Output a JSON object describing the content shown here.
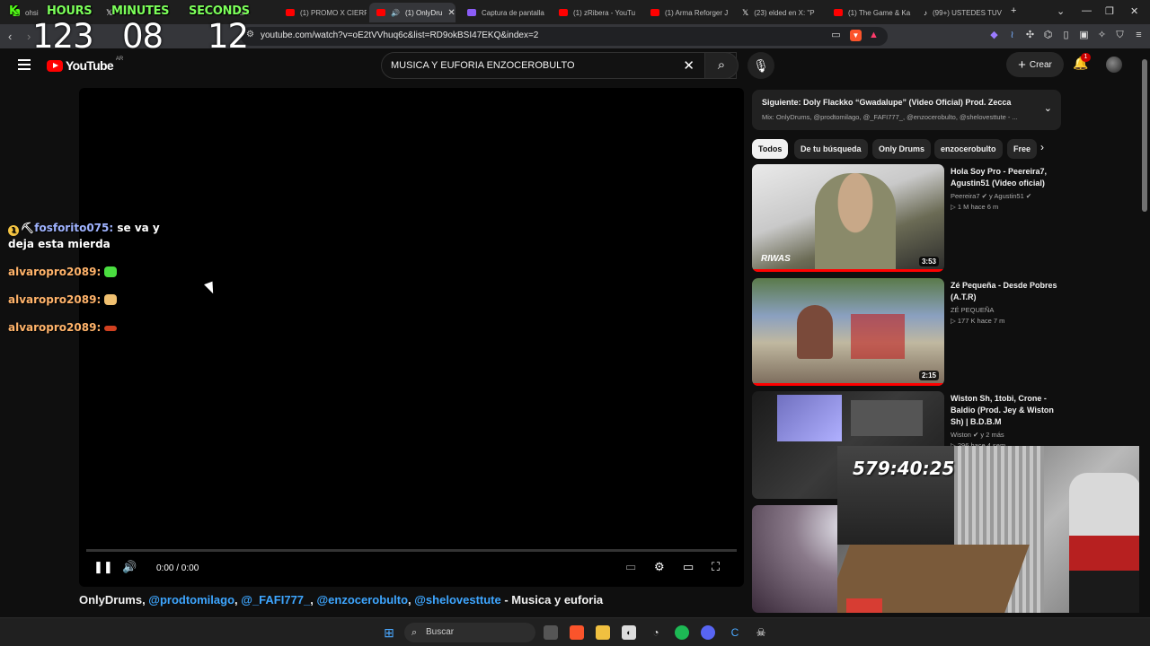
{
  "overlay": {
    "hours_label": "HOURS",
    "minutes_label": "MINUTES",
    "seconds_label": "SECONDS",
    "hours": "123",
    "minutes": "08",
    "seconds": "12"
  },
  "tabs": [
    {
      "label": "ohsi",
      "favicon": "kick-icon",
      "active": false
    },
    {
      "label": "",
      "favicon": "x-icon",
      "active": false
    },
    {
      "label": "ram",
      "favicon": "",
      "active": false
    },
    {
      "label": "(1) PROMO X CIERR",
      "favicon": "youtube-icon",
      "active": false
    },
    {
      "label": "(1) OnlyDru",
      "favicon": "youtube-icon",
      "active": true
    },
    {
      "label": "Captura de pantalla",
      "favicon": "pen-icon",
      "active": false
    },
    {
      "label": "(1) zRibera - YouTu",
      "favicon": "youtube-icon",
      "active": false
    },
    {
      "label": "(1) Arma Reforger J",
      "favicon": "youtube-icon",
      "active": false
    },
    {
      "label": "(23) elded en X: \"P",
      "favicon": "x-icon",
      "active": false
    },
    {
      "label": "(1) The Game & Ka",
      "favicon": "youtube-icon",
      "active": false
    },
    {
      "label": "(99+) USTEDES TUV",
      "favicon": "tiktok-icon",
      "active": false
    }
  ],
  "address": {
    "url": "youtube.com/watch?v=oE2tVVhuq6c&list=RD9okBSI47EKQ&index=2"
  },
  "youtube": {
    "logo_text": "YouTube",
    "country": "AR",
    "search_query": "MUSICA Y EUFORIA ENZOCEROBULTO",
    "create_label": "Crear",
    "notif_count": "1"
  },
  "player": {
    "time": "0:00 / 0:00",
    "title_prefix": "OnlyDrums, ",
    "mention1": "@prodtomilago",
    "sep1": ", ",
    "mention2": "@_FAFI777_",
    "sep2": ", ",
    "mention3": "@enzocerobulto",
    "sep3": ", ",
    "mention4": "@shelovesttute",
    "title_suffix": " - Musica y euforia"
  },
  "chat": [
    {
      "user": "fosforito075",
      "message": " se va y deja esta mierda",
      "has_badge": true
    },
    {
      "user": "alvaropro2089",
      "message": "",
      "emote_color": "#4ade40"
    },
    {
      "user": "alvaropro2089",
      "message": "",
      "emote_color": "#f0c070"
    },
    {
      "user": "alvaropro2089",
      "message": "",
      "emote_color": "#d04020"
    }
  ],
  "up_next": {
    "title": "Siguiente: Doly Flackko “Gwadalupe” (Video Oficial) Prod. Zecca",
    "subtitle": "Mix: OnlyDrums, @prodtomilago, @_FAFI777_, @enzocerobulto, @shelovesttute - ..."
  },
  "chips": [
    "Todos",
    "De tu búsqueda",
    "Only Drums",
    "enzocerobulto",
    "Free"
  ],
  "videos": [
    {
      "title": "Hola Soy Pro - Peereira7, Agustin51 (Video oficial)",
      "channel": "Peereira7 ✔ y Agustin51 ✔",
      "meta": "▷ 1 M  hace 6 m",
      "duration": "3:53",
      "thumb_text": "RIWAS"
    },
    {
      "title": "Zé Pequeña - Desde Pobres (A.T.R)",
      "channel": "ZÉ PEQUEÑA",
      "meta": "▷ 177 K  hace 7 m",
      "duration": "2:15",
      "thumb_text": ""
    },
    {
      "title": "Wiston Sh, 1tobi, Crone - Baldio (Prod. Jey & Wiston Sh) | B.D.B.M",
      "channel": "Wiston ✔ y 2 más",
      "meta": "▷ 296 hace 4 sem",
      "duration": "",
      "thumb_text": ""
    },
    {
      "title": "",
      "channel": "",
      "meta": "",
      "duration": "",
      "thumb_text": ""
    }
  ],
  "webcam": {
    "timer": "579:40:25"
  },
  "taskbar": {
    "search_label": "Buscar"
  },
  "colors": {
    "youtube_red": "#ff0000",
    "link_blue": "#3ea6ff",
    "overlay_green": "#7CFF5A"
  }
}
